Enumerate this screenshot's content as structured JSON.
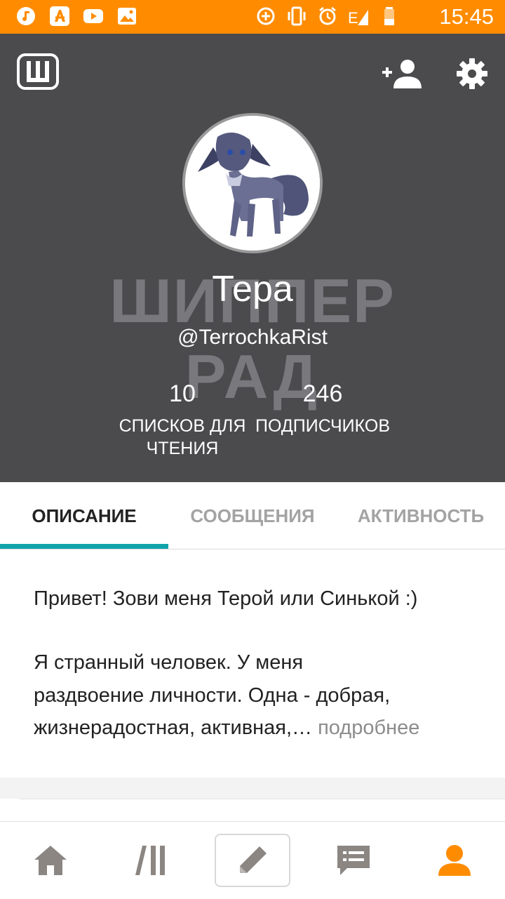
{
  "status_bar": {
    "time": "15:45",
    "network": "E",
    "colors": {
      "background": "#ff8c00"
    },
    "icons": [
      "music-icon",
      "font-app-icon",
      "youtube-icon",
      "gallery-icon",
      "data-saver-icon",
      "vibrate-icon",
      "alarm-icon",
      "signal-icon",
      "battery-icon"
    ]
  },
  "header": {
    "colors": {
      "background": "#4b4a4d"
    },
    "logo_letter": "Ш"
  },
  "watermark": {
    "line1": "ШИППЕР",
    "line2": "РАД"
  },
  "profile": {
    "display_name": "Тера",
    "username": "@TerrochkaRist",
    "reading_lists_count": "10",
    "reading_lists_label": "СПИСКОВ ДЛЯ ЧТЕНИЯ",
    "followers_count": "246",
    "followers_label": "ПОДПИСЧИКОВ"
  },
  "tabs": [
    {
      "label": "ОПИСАНИЕ",
      "active": true
    },
    {
      "label": "СООБЩЕНИЯ",
      "active": false
    },
    {
      "label": "АКТИВНОСТЬ",
      "active": false
    }
  ],
  "description": {
    "paragraph1": "Привет! Зови меня Терой или Синькой :)",
    "line1": "Я странный человек. У меня",
    "line2": "раздвоение личности. Одна - добрая,",
    "line3": "жизнерадостная, активная,…",
    "more_link": "подробнее"
  },
  "accent_color": "#10a3ac",
  "profile_nav_color": "#ff8c00",
  "bottom_nav": [
    "home-icon",
    "library-icon",
    "write-icon",
    "messages-icon",
    "profile-icon"
  ]
}
